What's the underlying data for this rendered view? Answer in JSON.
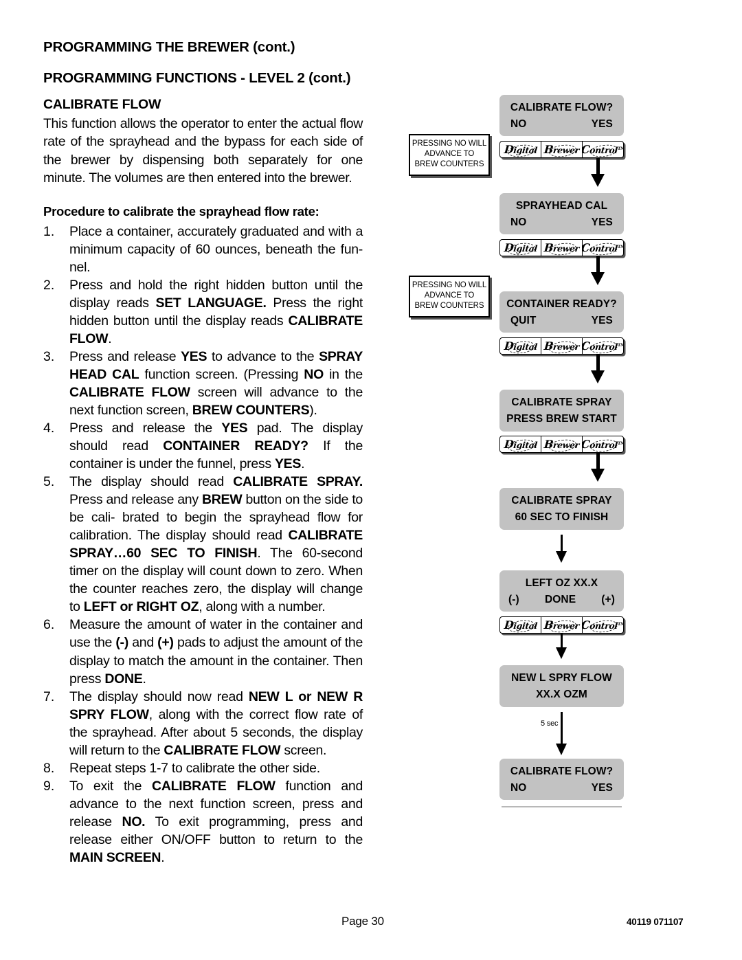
{
  "document": {
    "heading_main": "PROGRAMMING THE BREWER (cont.)",
    "heading_sub": "PROGRAMMING FUNCTIONS - LEVEL  2 (cont.)",
    "section_title": "CALIBRATE FLOW",
    "intro": "This function allows the operator to enter the actual flow rate of the sprayhead and the bypass for each side of the brewer by dispensing both separately for one minute. The volumes are then entered into the brewer.",
    "procedure_heading": "Procedure to calibrate the sprayhead flow rate:"
  },
  "footer": {
    "page_label": "Page 30",
    "doc_code": "40119 071107"
  },
  "steps": [
    {
      "number": "1.",
      "text": "Place a container, accurately graduated and with a minimum capacity of 60 ounces, beneath the funnel."
    },
    {
      "number": "2.",
      "text": "Press and hold the right hidden button until the display reads SET LANGUAGE. Press the right hidden button until the display reads CALIBRATE FLOW."
    },
    {
      "number": "3.",
      "text": "Press and release YES to advance to the SPRAY HEAD CAL function screen. (Pressing NO in the CALIBRATE FLOW screen will advance to the next function screen, BREW COUNTERS)."
    },
    {
      "number": "4.",
      "text": "Press and release the YES pad. The display should read CONTAINER READY? If the container is under the funnel, press YES."
    },
    {
      "number": "5.",
      "text": "The display should read CALIBRATE SPRAY. Press and release any BREW button on the side to be calibrated to begin the sprayhead flow for calibration. The display should read CALIBRATE SPRAY...60 SEC TO FINISH. The 60-second timer on the display will count down to zero. When the counter reaches zero, the display will change to LEFT or RIGHT OZ, along with a number."
    },
    {
      "number": "6.",
      "text": "Measure the amount of water in the container and use the (-) and (+) pads to adjust the amount of the display to match the amount in the container. Then press DONE."
    },
    {
      "number": "7.",
      "text": "The display should now read NEW L or NEW R SPRY FLOW, along with the correct flow rate of the sprayhead. After about 5 seconds, the display will return to the CALIBRATE FLOW screen."
    },
    {
      "number": "8.",
      "text": "Repeat steps 1-7 to calibrate the other side."
    },
    {
      "number": "9.",
      "text": "To exit the CALIBRATE FLOW function and advance to the next function screen, press and release NO. To exit programming, press and release either ON/OFF button to return to the MAIN SCREEN."
    }
  ],
  "flowchart": {
    "logo_cells": [
      "Digital",
      "Brewer",
      "Control"
    ],
    "logo_trademark": "TM",
    "timer_label": "5 sec",
    "notes": [
      {
        "lines": [
          "PRESSING NO WILL",
          "ADVANCE TO",
          "BREW COUNTERS"
        ]
      },
      {
        "lines": [
          "PRESSING NO WILL",
          "ADVANCE TO",
          "BREW COUNTERS"
        ]
      }
    ],
    "screens": [
      {
        "title": "CALIBRATE FLOW?",
        "left_option": "NO",
        "right_option": "YES"
      },
      {
        "title": "SPRAYHEAD  CAL",
        "left_option": "NO",
        "right_option": "YES"
      },
      {
        "title": "CONTAINER READY?",
        "left_option": "QUIT",
        "right_option": "YES"
      },
      {
        "title": "CALIBRATE SPRAY",
        "subtitle": "PRESS BREW START"
      },
      {
        "title": "CALIBRATE SPRAY",
        "subtitle": "60 SEC TO FINISH"
      },
      {
        "title": "LEFT OZ XX.X",
        "left_option": "(-)",
        "middle_option": "DONE",
        "right_option": "(+)"
      },
      {
        "title": "NEW L SPRY FLOW",
        "subtitle": "XX.X  OZM"
      },
      {
        "title": "CALIBRATE FLOW?",
        "left_option": "NO",
        "right_option": "YES"
      }
    ]
  }
}
